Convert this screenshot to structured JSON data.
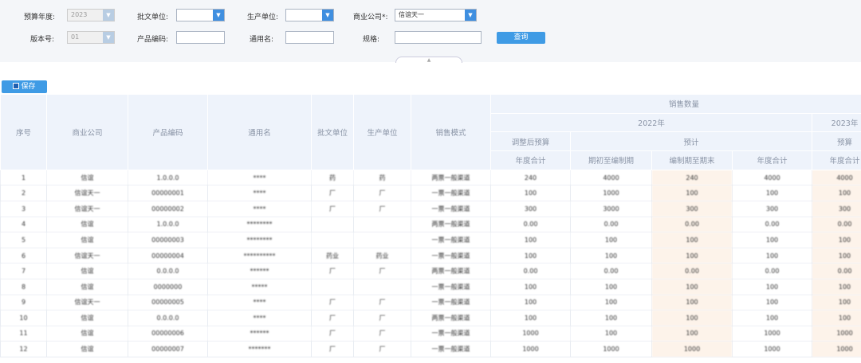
{
  "filters": {
    "budget_year": {
      "label": "预算年度:",
      "value": "2023"
    },
    "approval_unit": {
      "label": "批文单位:",
      "value": ""
    },
    "producer": {
      "label": "生产单位:",
      "value": ""
    },
    "company": {
      "label": "商业公司*:",
      "value": "信谊天一"
    },
    "version": {
      "label": "版本号:",
      "value": "01"
    },
    "product_code": {
      "label": "产品编码:",
      "value": ""
    },
    "generic_name": {
      "label": "通用名:",
      "value": ""
    },
    "spec": {
      "label": "规格:",
      "value": ""
    },
    "query_label": "查询"
  },
  "toolbar": {
    "save_label": "保存"
  },
  "table": {
    "headers": {
      "seq": "序号",
      "company": "商业公司",
      "code": "产品编码",
      "name": "通用名",
      "approval": "批文单位",
      "producer": "生产单位",
      "mode": "销售模式",
      "sales_qty": "销售数量",
      "y2022": "2022年",
      "y2023": "2023年",
      "adjusted": "调整后预算",
      "forecast": "预计",
      "budget": "预算",
      "annual_total": "年度合计",
      "start_to_prep": "期初至编制期",
      "prep_to_end": "编制期至期末",
      "annual_total2": "年度合计",
      "annual_total3": "年度合计"
    },
    "rows": [
      [
        "1",
        "信谊",
        "1.0.0.0",
        "****",
        "药",
        "药",
        "两票一般渠道",
        "240",
        "4000",
        "240",
        "4000",
        "4000"
      ],
      [
        "2",
        "信谊天一",
        "00000001",
        "****",
        "厂",
        "厂",
        "一票一般渠道",
        "100",
        "1000",
        "100",
        "100",
        "100"
      ],
      [
        "3",
        "信谊天一",
        "00000002",
        "****",
        "厂",
        "厂",
        "一票一般渠道",
        "300",
        "3000",
        "300",
        "300",
        "300"
      ],
      [
        "4",
        "信谊",
        "1.0.0.0",
        "********",
        "",
        "",
        "两票一般渠道",
        "0.00",
        "0.00",
        "0.00",
        "0.00",
        "0.00"
      ],
      [
        "5",
        "信谊",
        "00000003",
        "********",
        "",
        "",
        "一票一般渠道",
        "100",
        "100",
        "100",
        "100",
        "100"
      ],
      [
        "6",
        "信谊天一",
        "00000004",
        "**********",
        "药业",
        "药业",
        "一票一般渠道",
        "100",
        "100",
        "100",
        "100",
        "100"
      ],
      [
        "7",
        "信谊",
        "0.0.0.0",
        "******",
        "厂",
        "厂",
        "两票一般渠道",
        "0.00",
        "0.00",
        "0.00",
        "0.00",
        "0.00"
      ],
      [
        "8",
        "信谊",
        "0000000",
        "*****",
        "",
        "",
        "一票一般渠道",
        "100",
        "100",
        "100",
        "100",
        "100"
      ],
      [
        "9",
        "信谊天一",
        "00000005",
        "****",
        "厂",
        "厂",
        "一票一般渠道",
        "100",
        "100",
        "100",
        "100",
        "100"
      ],
      [
        "10",
        "信谊",
        "0.0.0.0",
        "****",
        "厂",
        "厂",
        "两票一般渠道",
        "100",
        "100",
        "100",
        "100",
        "100"
      ],
      [
        "11",
        "信谊",
        "00000006",
        "******",
        "厂",
        "厂",
        "一票一般渠道",
        "1000",
        "100",
        "100",
        "1000",
        "1000"
      ],
      [
        "12",
        "信谊",
        "00000007",
        "*******",
        "厂",
        "厂",
        "一票一般渠道",
        "1000",
        "1000",
        "1000",
        "1000",
        "1000"
      ]
    ]
  }
}
